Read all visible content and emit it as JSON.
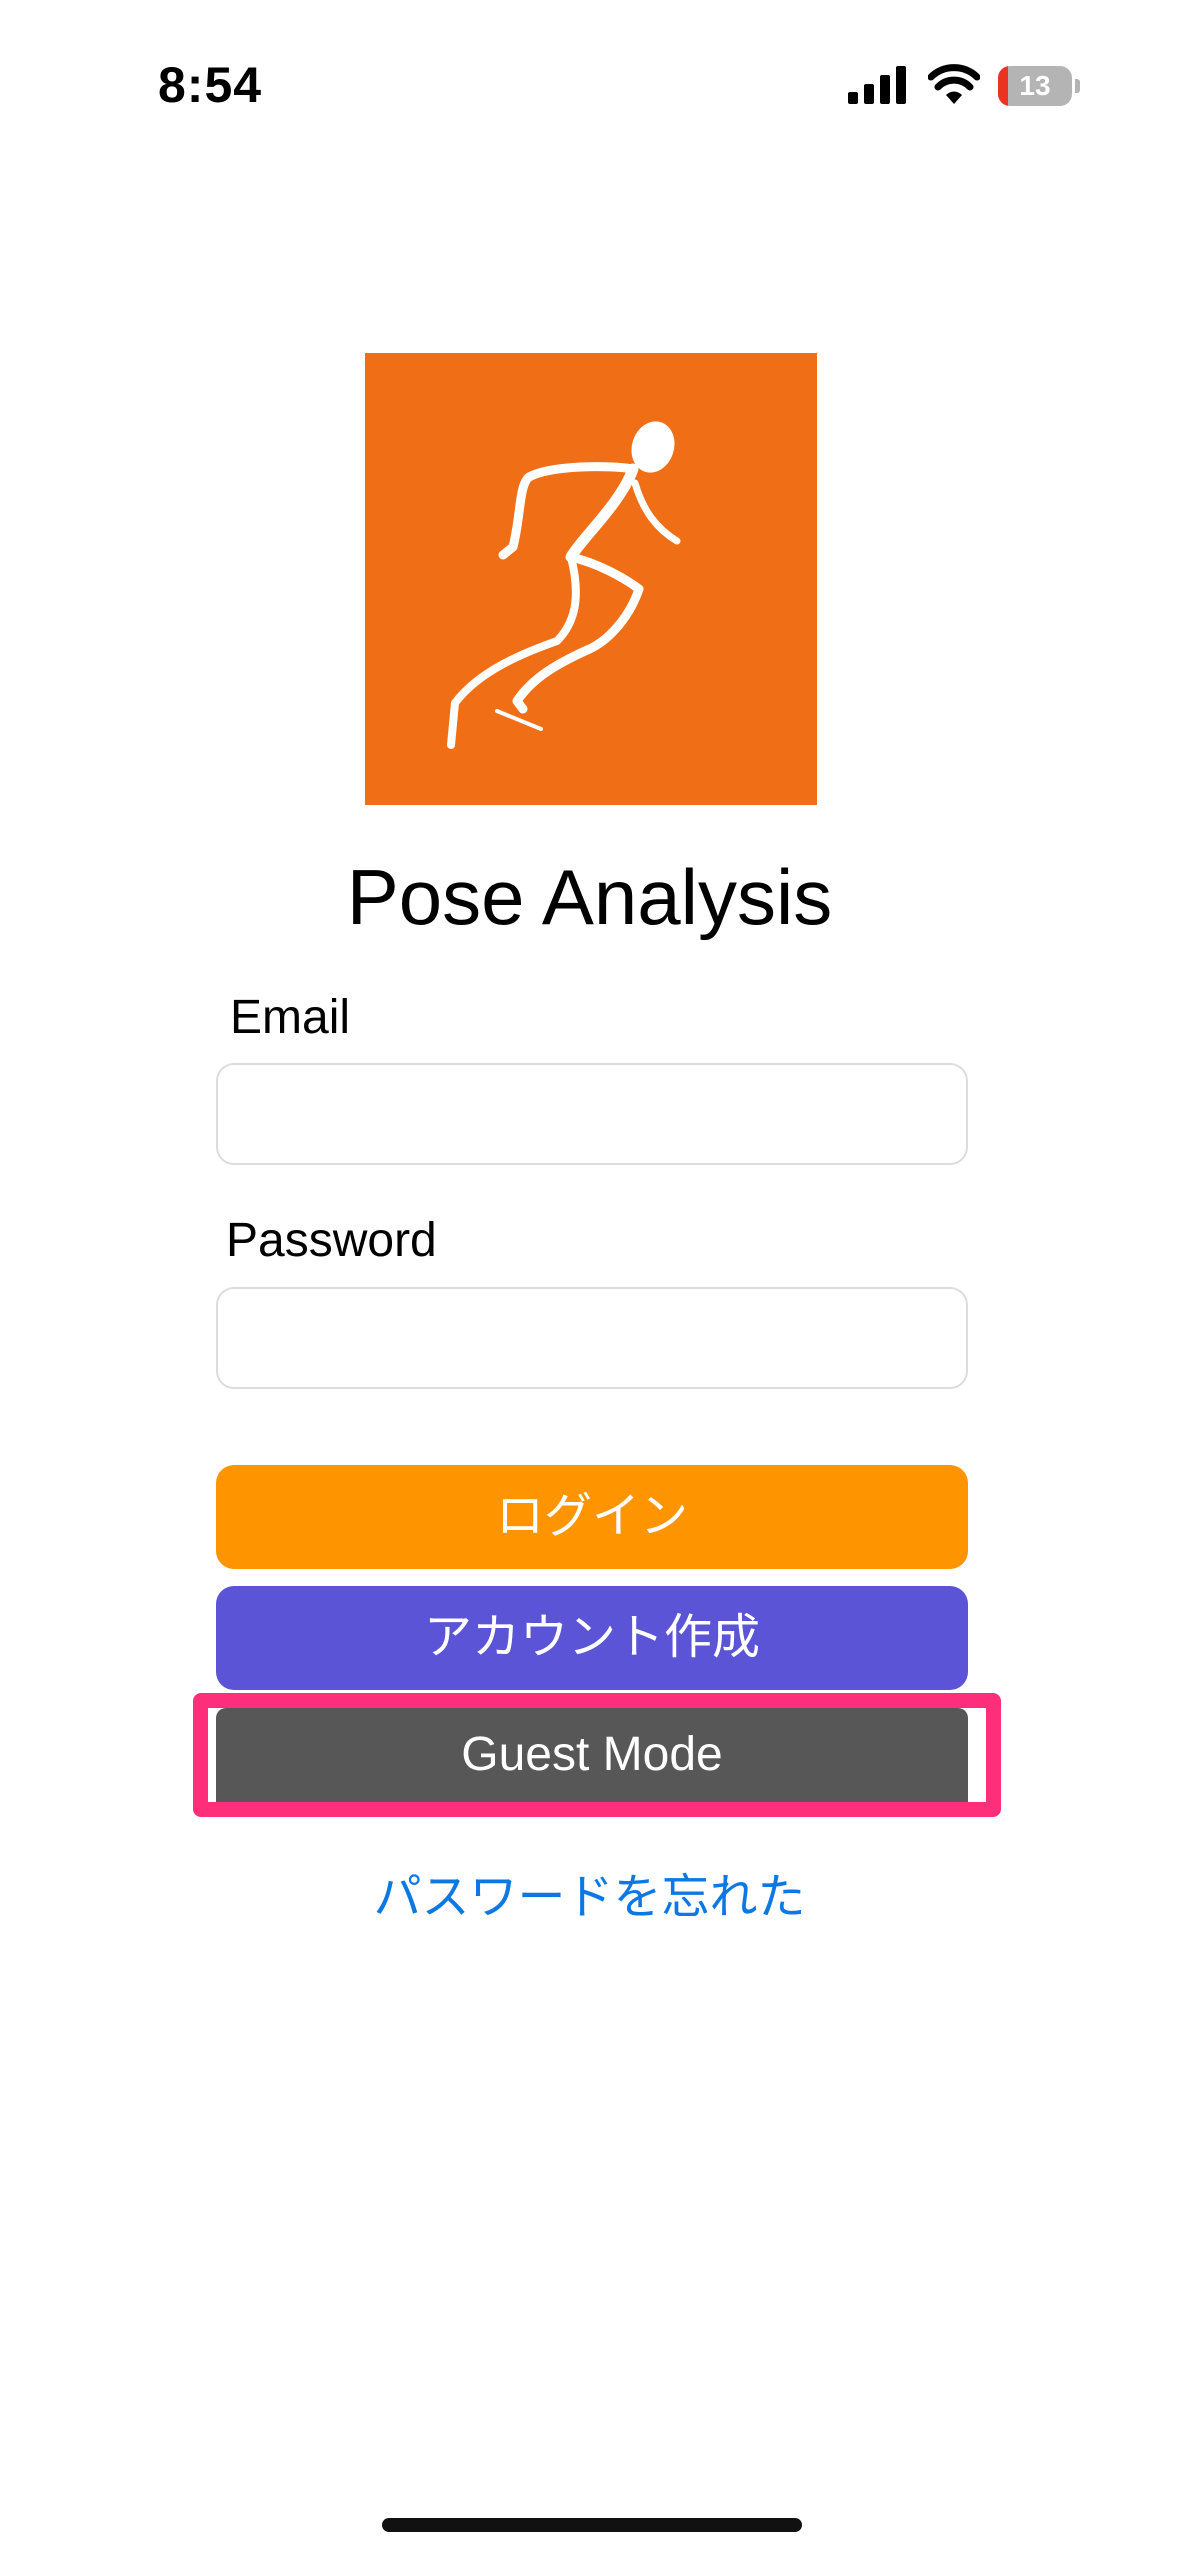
{
  "status_bar": {
    "time": "8:54",
    "battery_level": "13",
    "battery_fraction": 0.13
  },
  "app": {
    "title": "Pose Analysis"
  },
  "form": {
    "email_label": "Email",
    "email_value": "",
    "password_label": "Password",
    "password_value": ""
  },
  "buttons": {
    "login_label": "ログイン",
    "signup_label": "アカウント作成",
    "guest_label": "Guest Mode",
    "forgot_label": "パスワードを忘れた"
  },
  "colors": {
    "logo_background": "#f06e16",
    "login_button": "#fe9500",
    "signup_button": "#5b54d6",
    "guest_button": "#575757",
    "highlight": "#fe2f7a",
    "link": "#0d78e4"
  },
  "icons": [
    "signal-icon",
    "wifi-icon",
    "battery-icon",
    "runner-icon"
  ]
}
